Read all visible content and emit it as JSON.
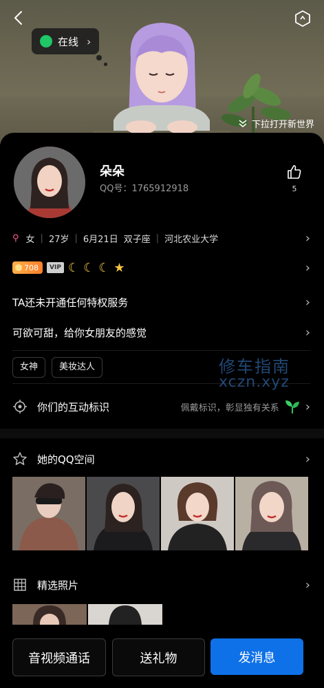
{
  "hero": {
    "online_label": "在线",
    "pulldown_label": "下拉打开新世界"
  },
  "profile": {
    "nickname": "朵朵",
    "qq_number": "QQ号：1765912918",
    "like_count": "5",
    "gender": "女",
    "age": "27岁",
    "birthday": "6月21日",
    "zodiac": "双子座",
    "school": "河北农业大学",
    "level": "708",
    "vip": "VIP"
  },
  "rows": {
    "privilege": "TA还未开通任何特权服务",
    "signature": "可欲可甜，给你女朋友的感觉",
    "interaction_title": "你们的互动标识",
    "interaction_hint": "佩戴标识，彰显独有关系"
  },
  "tags": [
    "女神",
    "美妆达人"
  ],
  "qzone": {
    "title": "她的QQ空间"
  },
  "photos": {
    "title": "精选照片"
  },
  "buttons": {
    "av_call": "音视频通话",
    "gift": "送礼物",
    "message": "发消息"
  },
  "watermark": {
    "cn": "修车指南",
    "en": "xczn.xyz"
  },
  "colors": {
    "accent": "#0f71e8",
    "online": "#1fc766",
    "level": "#ff8a2a",
    "gender": "#ff5a8a"
  }
}
